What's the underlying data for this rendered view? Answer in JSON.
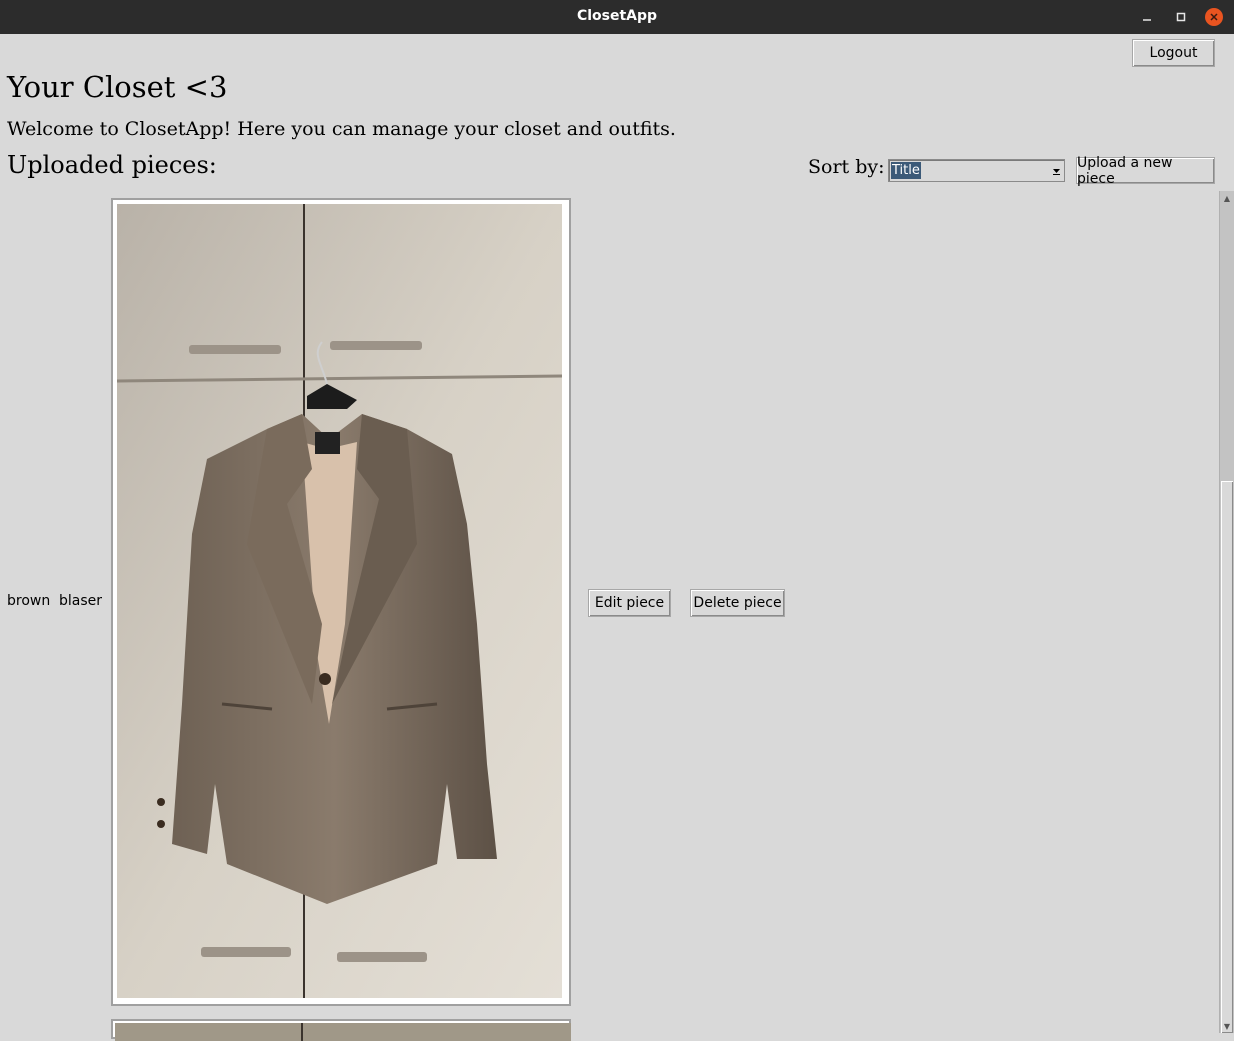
{
  "window": {
    "title": "ClosetApp",
    "controls": {
      "minimize": "–",
      "maximize": "□",
      "close": "✕"
    }
  },
  "header": {
    "logout_label": "Logout",
    "heading": "Your Closet <3",
    "welcome": "Welcome to ClosetApp! Here you can manage your closet and outfits."
  },
  "pieces_section": {
    "title": "Uploaded pieces:",
    "sort_label": "Sort by:",
    "sort_value": "Title",
    "upload_label": "Upload a new piece"
  },
  "pieces": [
    {
      "color": "brown",
      "type": "blaser",
      "edit_label": "Edit piece",
      "delete_label": "Delete piece"
    }
  ],
  "colors": {
    "titlebar": "#2c2c2c",
    "window_bg": "#d9d9d9",
    "close_button": "#e95420",
    "selection": "#3c5a78"
  },
  "icons": {
    "minimize": "minimize-icon",
    "maximize": "maximize-icon",
    "close": "close-icon",
    "dropdown": "chevron-down-icon"
  }
}
